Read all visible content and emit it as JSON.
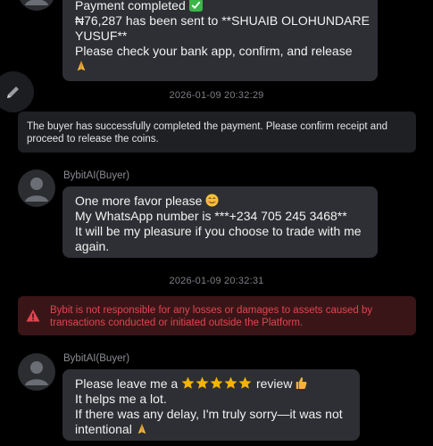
{
  "messages": {
    "first_bubble": {
      "line1": "Payment completed",
      "line2": "₦76,287 has been sent to **SHUAIB OLOHUNDARE",
      "line3": "YUSUF**",
      "line4": "Please check your bank app, confirm, and release"
    },
    "timestamp1": "2026-01-09 20:32:29",
    "system_notice": "The buyer has successfully completed the payment. Please confirm receipt and proceed to release the coins.",
    "sender1": "BybitAI(Buyer)",
    "second_bubble": {
      "line1": "One more favor please",
      "line2": "My WhatsApp number is ***+234 705 245 3468**",
      "line3": "It will be my pleasure if you choose to trade with me",
      "line4": "again."
    },
    "timestamp2": "2026-01-09 20:32:31",
    "warning": "Bybit is not responsible for any losses or damages to assets caused by transactions conducted or initiated outside the Platform.",
    "sender2": "BybitAI(Buyer)",
    "third_bubble": {
      "line1a": "Please leave me a",
      "line1b": "review",
      "line2": "It helps me a lot.",
      "line3": "If there was any delay, I'm truly sorry—it was not",
      "line4": "intentional"
    }
  },
  "icons": {
    "check": "check-mark-icon",
    "pray": "folded-hands-icon",
    "smile": "smiling-face-icon",
    "star": "star-icon",
    "thumb": "thumbs-up-icon",
    "warning": "warning-icon",
    "pencil": "pencil-icon",
    "avatar": "user-avatar-icon"
  },
  "colors": {
    "background": "#000000",
    "bubble": "#2d2f34",
    "warning_text": "#e0454f",
    "warning_bg": "#3a1518",
    "check_green": "#3bb54a",
    "star_gold": "#f5b400"
  }
}
